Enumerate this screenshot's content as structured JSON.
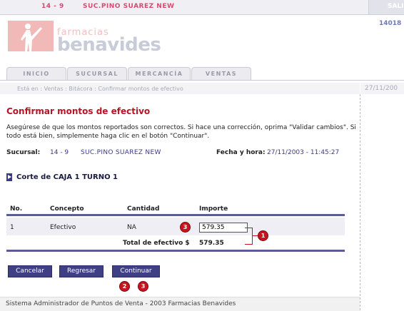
{
  "topbar": {
    "code": "14 - 9",
    "branch": "SUC.PINO SUAREZ NEW",
    "right_label": "SALI"
  },
  "right_id": "14018",
  "logo": {
    "small_text": "farmacias",
    "big_text": "benavides"
  },
  "tabs": [
    {
      "label": "INICIO"
    },
    {
      "label": "SUCURSAL"
    },
    {
      "label": "MERCANCÍA"
    },
    {
      "label": "VENTAS"
    }
  ],
  "breadcrumb": "Está en : Ventas : Bitácora : Confirmar montos de efectivo",
  "header_date": "27/11/200",
  "page_title": "Confirmar montos de efectivo",
  "instructions": "Asegúrese de que los montos reportados son correctos. Si hace una corrección, oprima \"Validar cambios\". Si todo está bien, simplemente haga clic en el botón \"Continuar\".",
  "info": {
    "sucursal_label": "Sucursal:",
    "sucursal_code": "14 - 9",
    "sucursal_name": "SUC.PINO SUAREZ NEW",
    "fecha_label": "Fecha y hora:",
    "fecha_value": "27/11/2003 - 11:45:27"
  },
  "corte_title": "Corte de CAJA  1   TURNO 1",
  "table": {
    "headers": [
      "No.",
      "Concepto",
      "Cantidad",
      "Importe"
    ],
    "rows": [
      {
        "no": "1",
        "concepto": "Efectivo",
        "cantidad": "NA",
        "importe": "579.35"
      }
    ],
    "total_label": "Total de efectivo $",
    "total_value": "579.35"
  },
  "callouts": [
    "1",
    "2",
    "3",
    "3"
  ],
  "buttons": {
    "cancel": "Cancelar",
    "back": "Regresar",
    "continue": "Continuar"
  },
  "footer": "Sistema Administrador de Puntos de Venta - 2003 Farmacias Benavides",
  "colors": {
    "accent_red": "#b81524",
    "button_blue": "#3f3f84",
    "brand_pink": "#f1b9b8"
  }
}
